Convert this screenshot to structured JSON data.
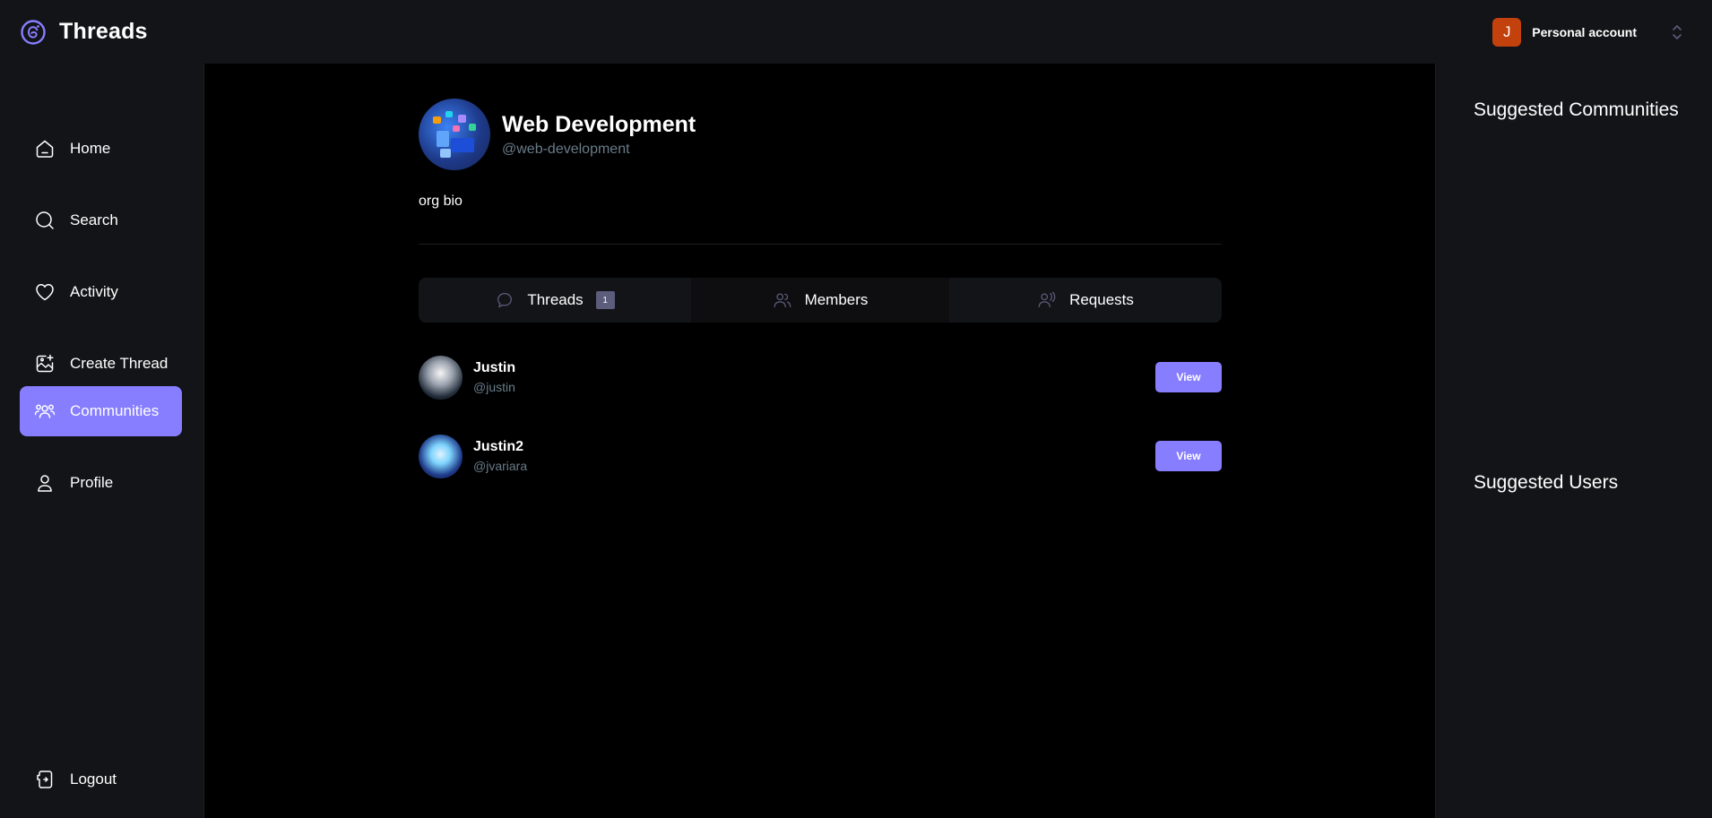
{
  "app": {
    "name": "Threads"
  },
  "account": {
    "initial": "J",
    "label": "Personal account"
  },
  "sidebar": {
    "items": [
      {
        "label": "Home",
        "icon": "home-icon"
      },
      {
        "label": "Search",
        "icon": "search-icon"
      },
      {
        "label": "Activity",
        "icon": "heart-icon"
      },
      {
        "label": "Create Thread",
        "icon": "create-thread-icon"
      },
      {
        "label": "Communities",
        "icon": "communities-icon",
        "active": true
      },
      {
        "label": "Profile",
        "icon": "user-icon"
      }
    ],
    "logout_label": "Logout"
  },
  "community": {
    "name": "Web Development",
    "handle": "@web-development",
    "bio": "org bio"
  },
  "tabs": [
    {
      "label": "Threads",
      "icon": "reply-icon",
      "badge": "1"
    },
    {
      "label": "Members",
      "icon": "members-icon",
      "active": true
    },
    {
      "label": "Requests",
      "icon": "request-icon"
    }
  ],
  "members": [
    {
      "name": "Justin",
      "handle": "@justin",
      "button": "View"
    },
    {
      "name": "Justin2",
      "handle": "@jvariara",
      "button": "View"
    }
  ],
  "rightbar": {
    "suggested_communities": "Suggested Communities",
    "suggested_users": "Suggested Users"
  },
  "colors": {
    "accent": "#877eff",
    "panel": "#121417",
    "muted": "#697c89",
    "avatar_orange": "#c2410c"
  }
}
